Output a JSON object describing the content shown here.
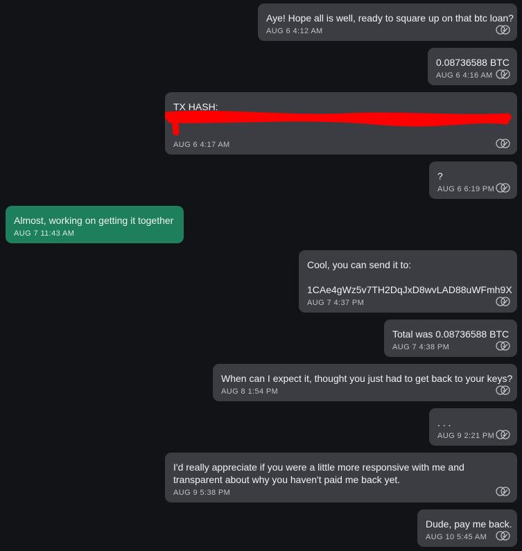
{
  "messages": [
    {
      "text": "Aye! Hope all is well, ready to square up on that btc loan?",
      "time": "AUG 6 4:12 AM",
      "direction": "outgoing",
      "status_icon": "read-receipt-icon"
    },
    {
      "text": "0.08736588 BTC",
      "time": "AUG 6 4:16 AM",
      "direction": "outgoing",
      "status_icon": "read-receipt-icon"
    },
    {
      "text": "TX HASH:",
      "time": "AUG 6 4:17 AM",
      "direction": "outgoing",
      "status_icon": "read-receipt-icon",
      "redaction_color": "#ff0000"
    },
    {
      "text": "?",
      "time": "AUG 6 6:19 PM",
      "direction": "outgoing",
      "status_icon": "read-receipt-icon"
    },
    {
      "text": "Almost, working on getting it together",
      "time": "AUG 7 11:43 AM",
      "direction": "incoming"
    },
    {
      "text": "Cool, you can send it to:\n\n1CAe4gWz5v7TH2DqJxD8wvLAD88uWFmh9X",
      "time": "AUG 7 4:37 PM",
      "direction": "outgoing",
      "status_icon": "read-receipt-icon"
    },
    {
      "text": "Total was 0.08736588 BTC",
      "time": "AUG 7 4:38 PM",
      "direction": "outgoing",
      "status_icon": "read-receipt-icon"
    },
    {
      "text": "When can I expect it, thought you just had to get back to your keys?",
      "time": "AUG 8 1:54 PM",
      "direction": "outgoing",
      "status_icon": "read-receipt-icon"
    },
    {
      "text": ". . .",
      "time": "AUG 9 2:21 PM",
      "direction": "outgoing",
      "status_icon": "read-receipt-icon"
    },
    {
      "text": "I'd really appreciate if you were a little more responsive with me and\ntransparent about why you haven't paid me back yet.",
      "time": "AUG 9 5:38 PM",
      "direction": "outgoing",
      "status_icon": "read-receipt-icon"
    },
    {
      "text": "Dude, pay me back.",
      "time": "AUG 10 5:45 AM",
      "direction": "outgoing",
      "status_icon": "read-receipt-icon"
    }
  ],
  "colors": {
    "background": "#121316",
    "outgoing_bubble": "#3c3d42",
    "incoming_bubble": "#1e7f5d",
    "text": "#f1f2f4",
    "timestamp": "#bfc1c6"
  }
}
